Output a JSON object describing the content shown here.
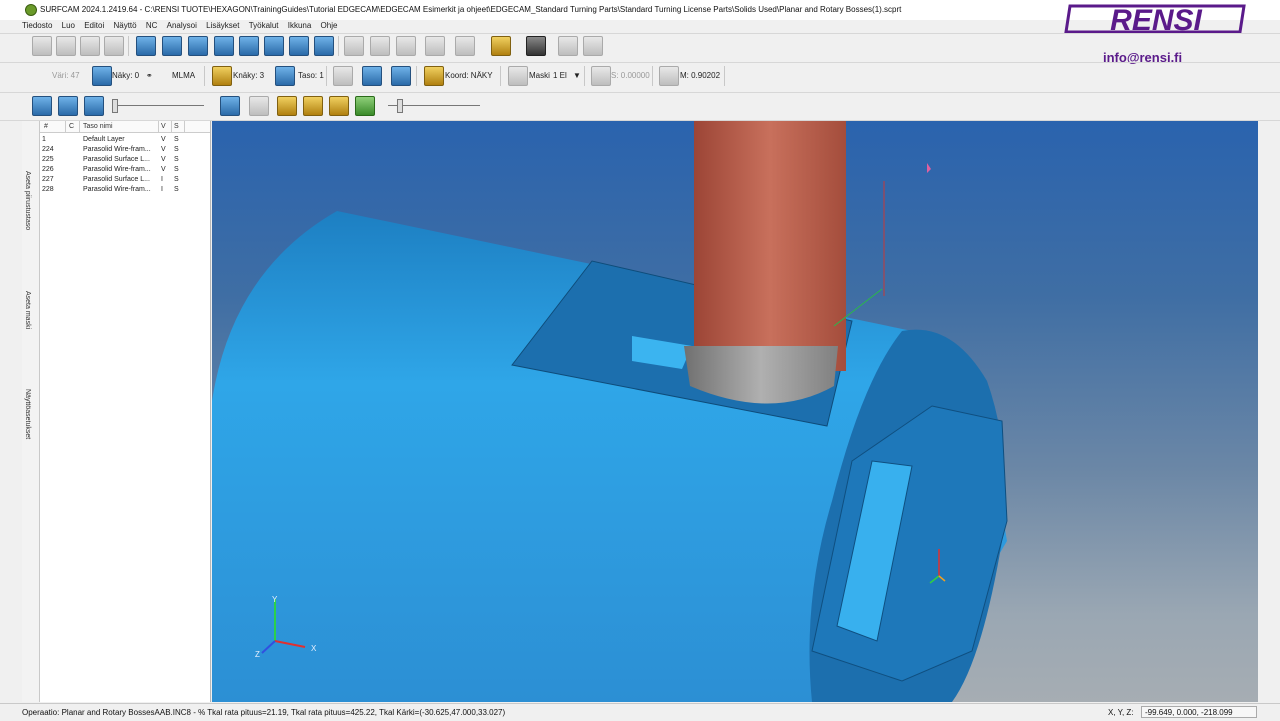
{
  "window": {
    "title": "SURFCAM 2024.1.2419.64 - C:\\RENSI TUOTE\\HEXAGON\\TrainingGuides\\Tutorial EDGECAM\\EDGECAM Esimerkit ja ohjeet\\EDGECAM_Standard Turning Parts\\Standard Turning License Parts\\Solids Used\\Planar and Rotary Bosses(1).scprt"
  },
  "logo": {
    "text": "RENSI",
    "color": "#5a1a8a",
    "email": "info@rensi.fi"
  },
  "menu": [
    "Tiedosto",
    "Luo",
    "Editoi",
    "Näyttö",
    "NC",
    "Analysoi",
    "Lisäykset",
    "Työkalut",
    "Ikkuna",
    "Ohje"
  ],
  "toolbar2": {
    "color_label": "Väri: 47",
    "view_label": "Näky: 0",
    "mlma_label": "MLMA",
    "cview_label": "Knäky: 3",
    "level_label": "Taso: 1",
    "coord_label": "Koord: NÄKY",
    "mask_label": "Maski",
    "mask_value": "1 El",
    "s_label": "S: 0.00000",
    "m_label": "M: 0.90202"
  },
  "left_tabs": [
    "Aseta piirustustaso",
    "Aseta maski",
    "Näyttöasetukset"
  ],
  "layer_table": {
    "columns": [
      "#",
      "C",
      "Taso nimi",
      "V",
      "S"
    ],
    "rows": [
      {
        "num": "1",
        "c": "",
        "name": "Default Layer",
        "v": "V",
        "s": "S"
      },
      {
        "num": "224",
        "c": "",
        "name": "Parasolid Wire-fram...",
        "v": "V",
        "s": "S"
      },
      {
        "num": "225",
        "c": "",
        "name": "Parasolid Surface L...",
        "v": "V",
        "s": "S"
      },
      {
        "num": "226",
        "c": "",
        "name": "Parasolid Wire-fram...",
        "v": "V",
        "s": "S"
      },
      {
        "num": "227",
        "c": "",
        "name": "Parasolid Surface L...",
        "v": "I",
        "s": "S"
      },
      {
        "num": "228",
        "c": "",
        "name": "Parasolid Wire-fram...",
        "v": "I",
        "s": "S"
      }
    ]
  },
  "viewport": {
    "axis_labels": {
      "x": "X",
      "y": "Y",
      "z": "Z"
    },
    "colors": {
      "part": "#2fa6e8",
      "tool": "#b85a48",
      "background_top": "#2a63ae",
      "background_bottom": "#a6adb3"
    }
  },
  "status": {
    "operation": "Operaatio: Planar and Rotary BossesAAB.INC8 - % Tkal rata pituus=21.19, Tkal rata pituus=425.22, Tkal Kärki=(-30.625,47.000,33.027)",
    "xyz_label": "X, Y, Z:",
    "coords": "-99.649, 0.000, -218.099"
  }
}
